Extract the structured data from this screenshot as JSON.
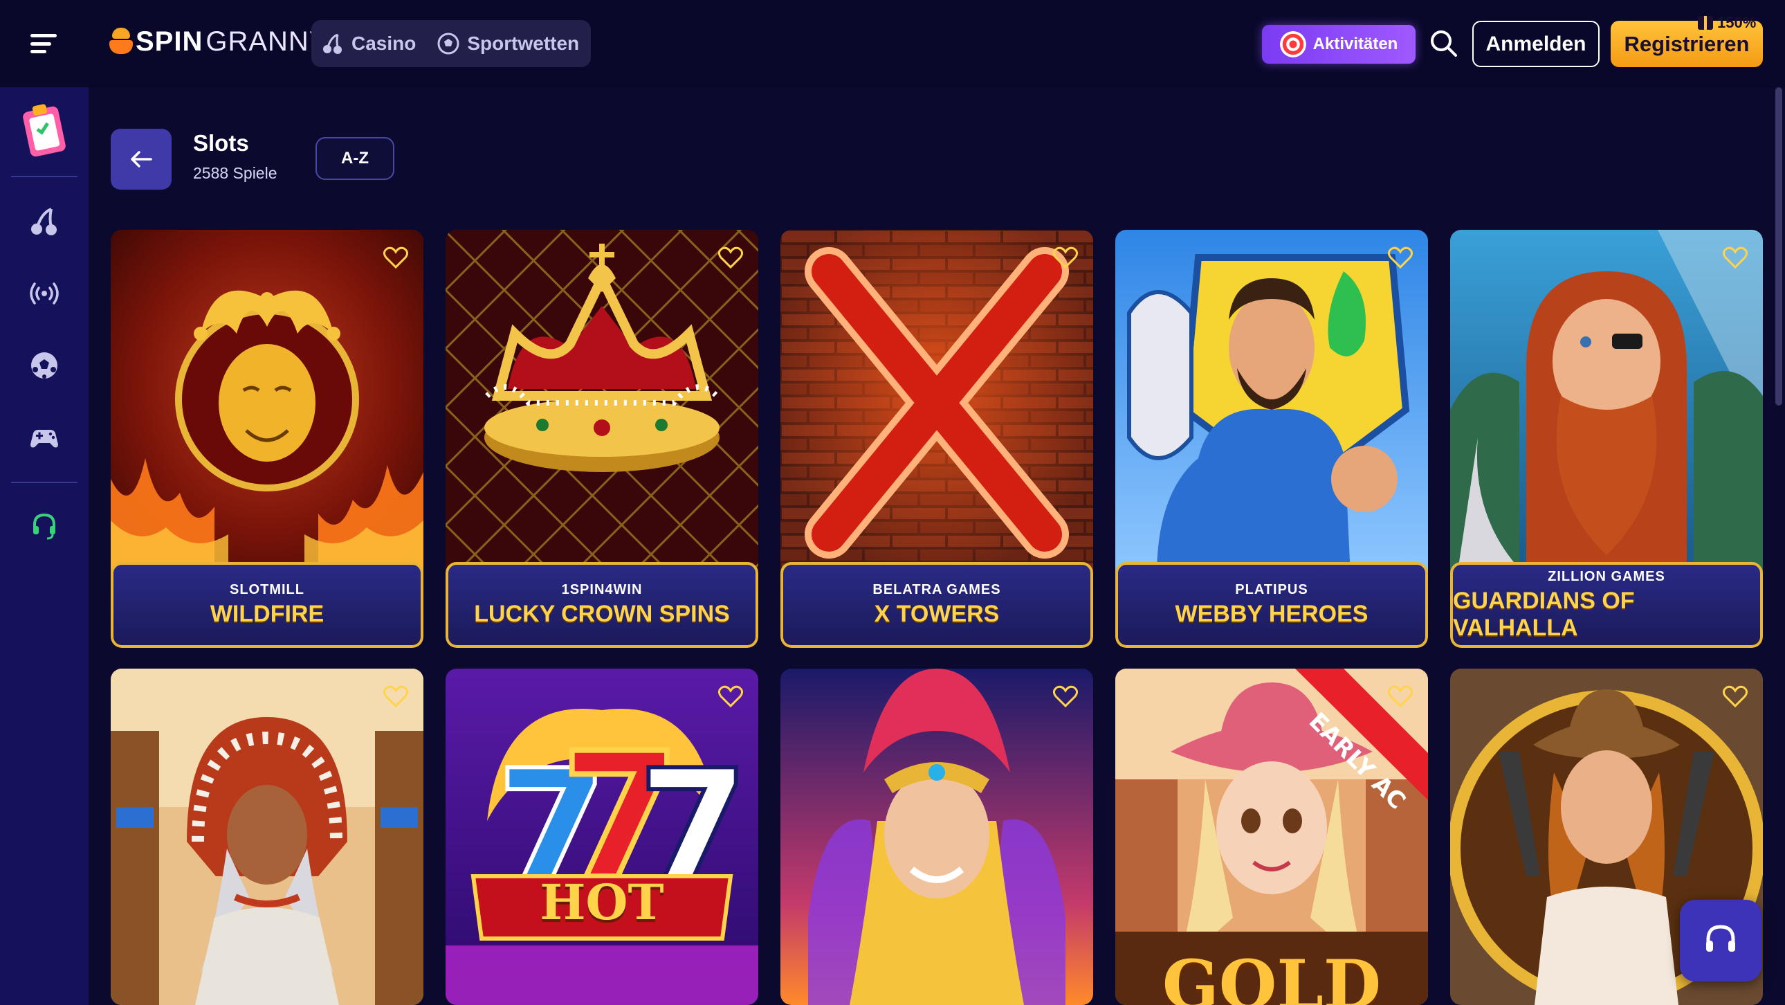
{
  "brand": {
    "logo_spin": "SPIN",
    "logo_granny": "GRANNY"
  },
  "header": {
    "tabs": [
      {
        "label": "Casino",
        "icon": "cherry-icon"
      },
      {
        "label": "Sportwetten",
        "icon": "soccer-ball-icon"
      }
    ],
    "activities_label": "Aktivitäten",
    "login_label": "Anmelden",
    "register_label": "Registrieren",
    "bonus_badge": "150%"
  },
  "sidebar": {
    "items": [
      {
        "name": "tasks",
        "icon": "clipboard-icon"
      },
      {
        "name": "casino",
        "icon": "cherry-icon"
      },
      {
        "name": "live",
        "icon": "broadcast-icon"
      },
      {
        "name": "sports",
        "icon": "soccer-ball-icon"
      },
      {
        "name": "games",
        "icon": "gamepad-icon"
      },
      {
        "name": "support",
        "icon": "headset-icon"
      }
    ]
  },
  "page": {
    "title": "Slots",
    "count": "2588 Spiele",
    "sort_label": "A-Z"
  },
  "games": [
    {
      "provider": "Slotmill",
      "name": "Wildfire"
    },
    {
      "provider": "1spin4win",
      "name": "Lucky Crown Spins"
    },
    {
      "provider": "Belatra Games",
      "name": "X Towers"
    },
    {
      "provider": "Platipus",
      "name": "Webby Heroes"
    },
    {
      "provider": "Zillion Games",
      "name": "Guardians of Valhalla"
    }
  ],
  "games_row2": [
    {
      "art_text": ""
    },
    {
      "art_text": "HOT"
    },
    {
      "art_text": ""
    },
    {
      "art_text": "EARLY AC",
      "art_text_2": "GOLD"
    },
    {
      "art_text": ""
    }
  ],
  "colors": {
    "background": "#0b0a2e",
    "sidebar": "#14125a",
    "accent_gold": "#e8b536",
    "register": "#ffc43b",
    "activities": "#7b3bf2"
  }
}
